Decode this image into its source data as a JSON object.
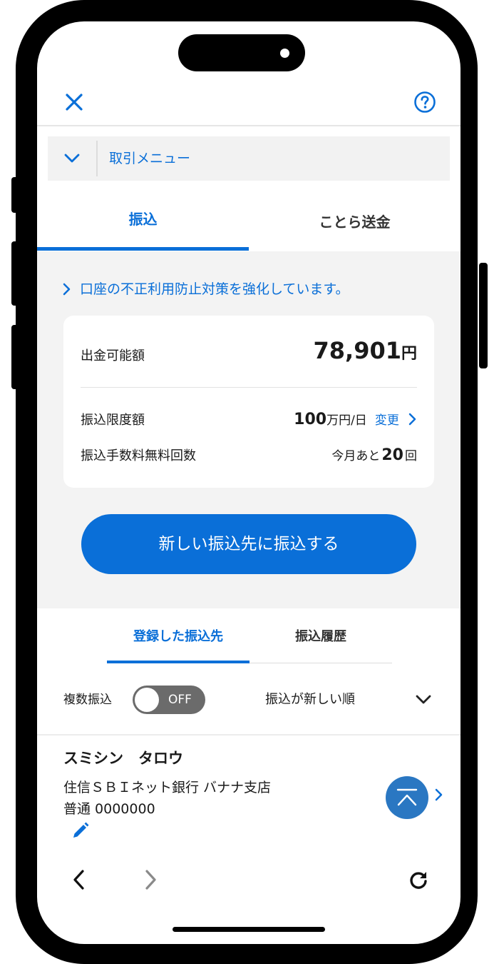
{
  "header": {
    "close_icon": "close-icon",
    "help_icon": "help-icon"
  },
  "menu": {
    "label": "取引メニュー",
    "icon": "chevron-down-icon"
  },
  "top_tabs": [
    {
      "label": "振込",
      "active": true
    },
    {
      "label": "ことら送金",
      "active": false
    }
  ],
  "notice": {
    "text": "口座の不正利用防止対策を強化しています。",
    "icon": "chevron-right-icon"
  },
  "balance": {
    "label": "出金可能額",
    "amount": "78,901",
    "unit": "円"
  },
  "limit": {
    "label": "振込限度額",
    "value": "100",
    "unit": "万円/日",
    "change_label": "変更"
  },
  "free_fee": {
    "label": "振込手数料無料回数",
    "prefix": "今月あと",
    "count": "20",
    "unit": "回"
  },
  "new_transfer_button": "新しい振込先に振込する",
  "sub_tabs": [
    {
      "label": "登録した振込先",
      "active": true
    },
    {
      "label": "振込履歴",
      "active": false
    }
  ],
  "multi_transfer": {
    "label": "複数振込",
    "toggle_state": "OFF"
  },
  "sort": {
    "label": "振込が新しい順"
  },
  "payee": {
    "name": "スミシン　タロウ",
    "bank": "住信ＳＢＩネット銀行 バナナ支店",
    "account": "普通 0000000"
  },
  "colors": {
    "accent": "#0a6fd8",
    "toggle_bg": "#6b6b6b",
    "section_bg": "#f3f3f3"
  }
}
